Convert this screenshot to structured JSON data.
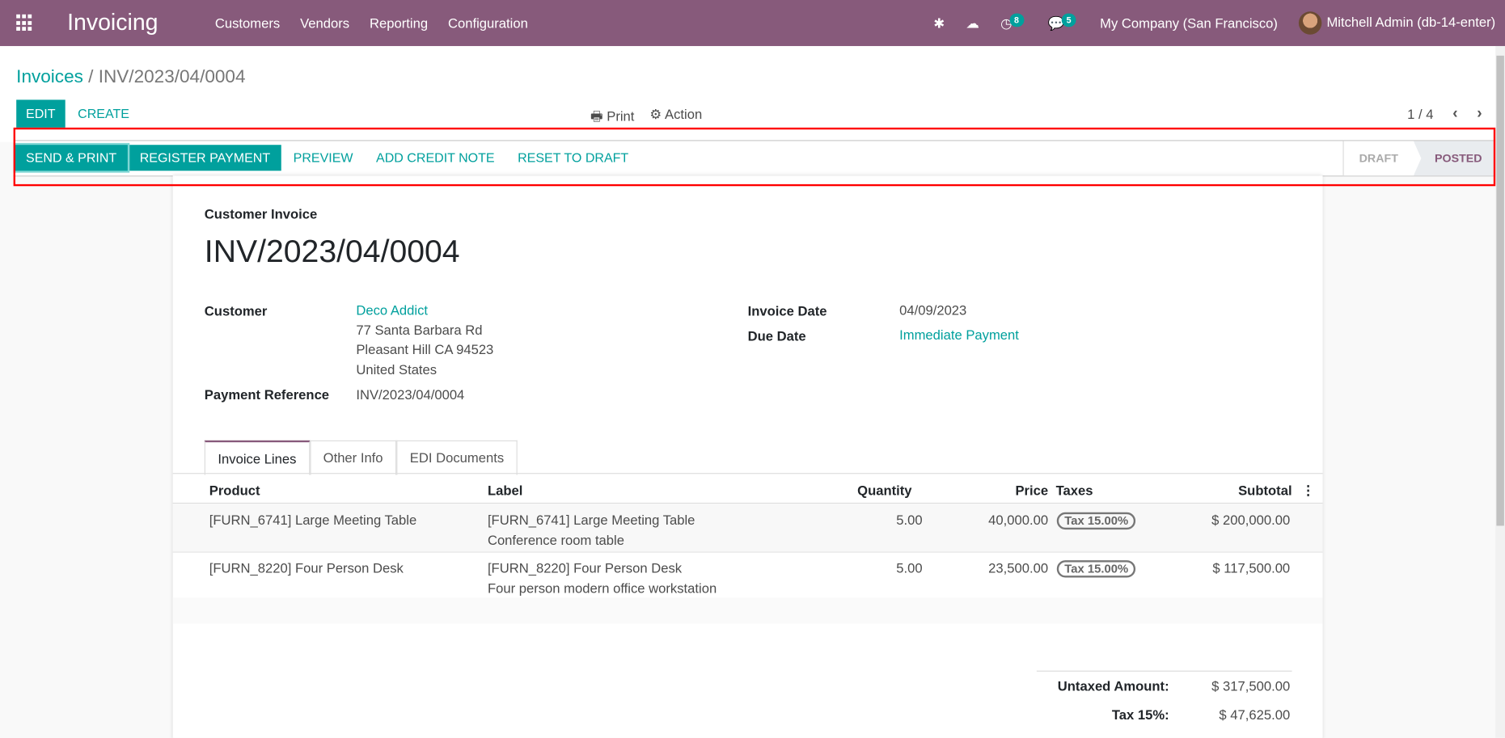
{
  "navbar": {
    "app_title": "Invoicing",
    "menu": [
      "Customers",
      "Vendors",
      "Reporting",
      "Configuration"
    ],
    "activity_count": "8",
    "message_count": "5",
    "company": "My Company (San Francisco)",
    "user": "Mitchell Admin (db-14-enter)"
  },
  "breadcrumb": {
    "parent": "Invoices",
    "separator": "/",
    "current": "INV/2023/04/0004"
  },
  "control": {
    "edit": "EDIT",
    "create": "CREATE",
    "print": "Print",
    "action": "Action",
    "pager": "1 / 4"
  },
  "statusbar": {
    "actions": [
      "SEND & PRINT",
      "REGISTER PAYMENT",
      "PREVIEW",
      "ADD CREDIT NOTE",
      "RESET TO DRAFT"
    ],
    "states": [
      "DRAFT",
      "POSTED"
    ],
    "current_state": "POSTED"
  },
  "invoice": {
    "type": "Customer Invoice",
    "number": "INV/2023/04/0004",
    "customer_label": "Customer",
    "customer": "Deco Addict",
    "address": [
      "77 Santa Barbara Rd",
      "Pleasant Hill CA 94523",
      "United States"
    ],
    "payment_ref_label": "Payment Reference",
    "payment_ref": "INV/2023/04/0004",
    "invoice_date_label": "Invoice Date",
    "invoice_date": "04/09/2023",
    "due_date_label": "Due Date",
    "due_date": "Immediate Payment"
  },
  "tabs": [
    "Invoice Lines",
    "Other Info",
    "EDI Documents"
  ],
  "lines": {
    "headers": [
      "Product",
      "Label",
      "Quantity",
      "Price",
      "Taxes",
      "Subtotal"
    ],
    "rows": [
      {
        "product": "[FURN_6741] Large Meeting Table",
        "label": "[FURN_6741] Large Meeting Table",
        "desc": "Conference room table",
        "qty": "5.00",
        "price": "40,000.00",
        "tax": "Tax 15.00%",
        "subtotal": "$ 200,000.00"
      },
      {
        "product": "[FURN_8220] Four Person Desk",
        "label": "[FURN_8220] Four Person Desk",
        "desc": "Four person modern office workstation",
        "qty": "5.00",
        "price": "23,500.00",
        "tax": "Tax 15.00%",
        "subtotal": "$ 117,500.00"
      }
    ]
  },
  "totals": {
    "untaxed_label": "Untaxed Amount:",
    "untaxed": "$ 317,500.00",
    "tax_label": "Tax 15%:",
    "tax": "$ 47,625.00"
  }
}
